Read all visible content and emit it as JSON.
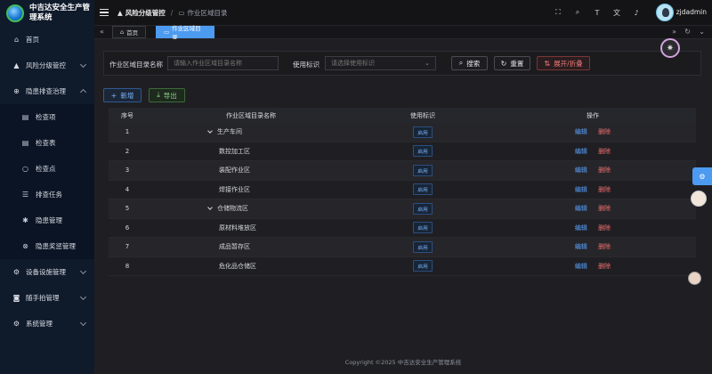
{
  "app": {
    "logo_text": "中吉达安全生产管理系统"
  },
  "sidebar": {
    "items": [
      {
        "label": "首页",
        "icon": "home-icon"
      },
      {
        "label": "风险分级管控",
        "icon": "warning-icon"
      },
      {
        "label": "隐患排查治理",
        "icon": "target-icon"
      },
      {
        "label": "检查项",
        "icon": "document-icon"
      },
      {
        "label": "检查表",
        "icon": "document-icon"
      },
      {
        "label": "检查点",
        "icon": "circle-icon"
      },
      {
        "label": "排查任务",
        "icon": "list-icon"
      },
      {
        "label": "隐患管理",
        "icon": "asterisk-icon"
      },
      {
        "label": "隐患奖惩管理",
        "icon": "close-circle-icon"
      },
      {
        "label": "设备设施管理",
        "icon": "gear-icon"
      },
      {
        "label": "随手拍管理",
        "icon": "camera-icon"
      },
      {
        "label": "系统管理",
        "icon": "gear-icon"
      }
    ]
  },
  "header": {
    "breadcrumb_1": "风险分级管控",
    "breadcrumb_sep": "/",
    "breadcrumb_2": "作业区域目录",
    "username": "zjdadmin"
  },
  "tabs": {
    "home": "首页",
    "active": "作业区域目录"
  },
  "search": {
    "name_label": "作业区域目录名称",
    "name_placeholder": "请输入作业区域目录名称",
    "flag_label": "使用标识",
    "flag_placeholder": "请选择使用标识",
    "search_button": "搜索",
    "reset_button": "重置",
    "expand_button": "展开/折叠"
  },
  "toolbar": {
    "add_button": "新增",
    "export_button": "导出"
  },
  "table": {
    "headers": [
      "序号",
      "作业区域目录名称",
      "使用标识",
      "操作"
    ],
    "rows": [
      {
        "no": "1",
        "name": "生产车间",
        "flag": "启用",
        "parent": true
      },
      {
        "no": "2",
        "name": "数控加工区",
        "flag": "启用",
        "parent": false
      },
      {
        "no": "3",
        "name": "装配作业区",
        "flag": "启用",
        "parent": false
      },
      {
        "no": "4",
        "name": "焊接作业区",
        "flag": "启用",
        "parent": false
      },
      {
        "no": "5",
        "name": "仓储物流区",
        "flag": "启用",
        "parent": true
      },
      {
        "no": "6",
        "name": "原材料堆放区",
        "flag": "启用",
        "parent": false
      },
      {
        "no": "7",
        "name": "成品暂存区",
        "flag": "启用",
        "parent": false
      },
      {
        "no": "8",
        "name": "危化品仓储区",
        "flag": "启用",
        "parent": false
      }
    ],
    "edit_label": "编辑",
    "delete_label": "删除"
  },
  "footer": {
    "text": "Copyright ©2025 中吉达安全生产管理系统"
  },
  "colors": {
    "accent": "#4d9bf0",
    "sidebar_bg": "#0f1a2b",
    "danger": "#f07070"
  }
}
